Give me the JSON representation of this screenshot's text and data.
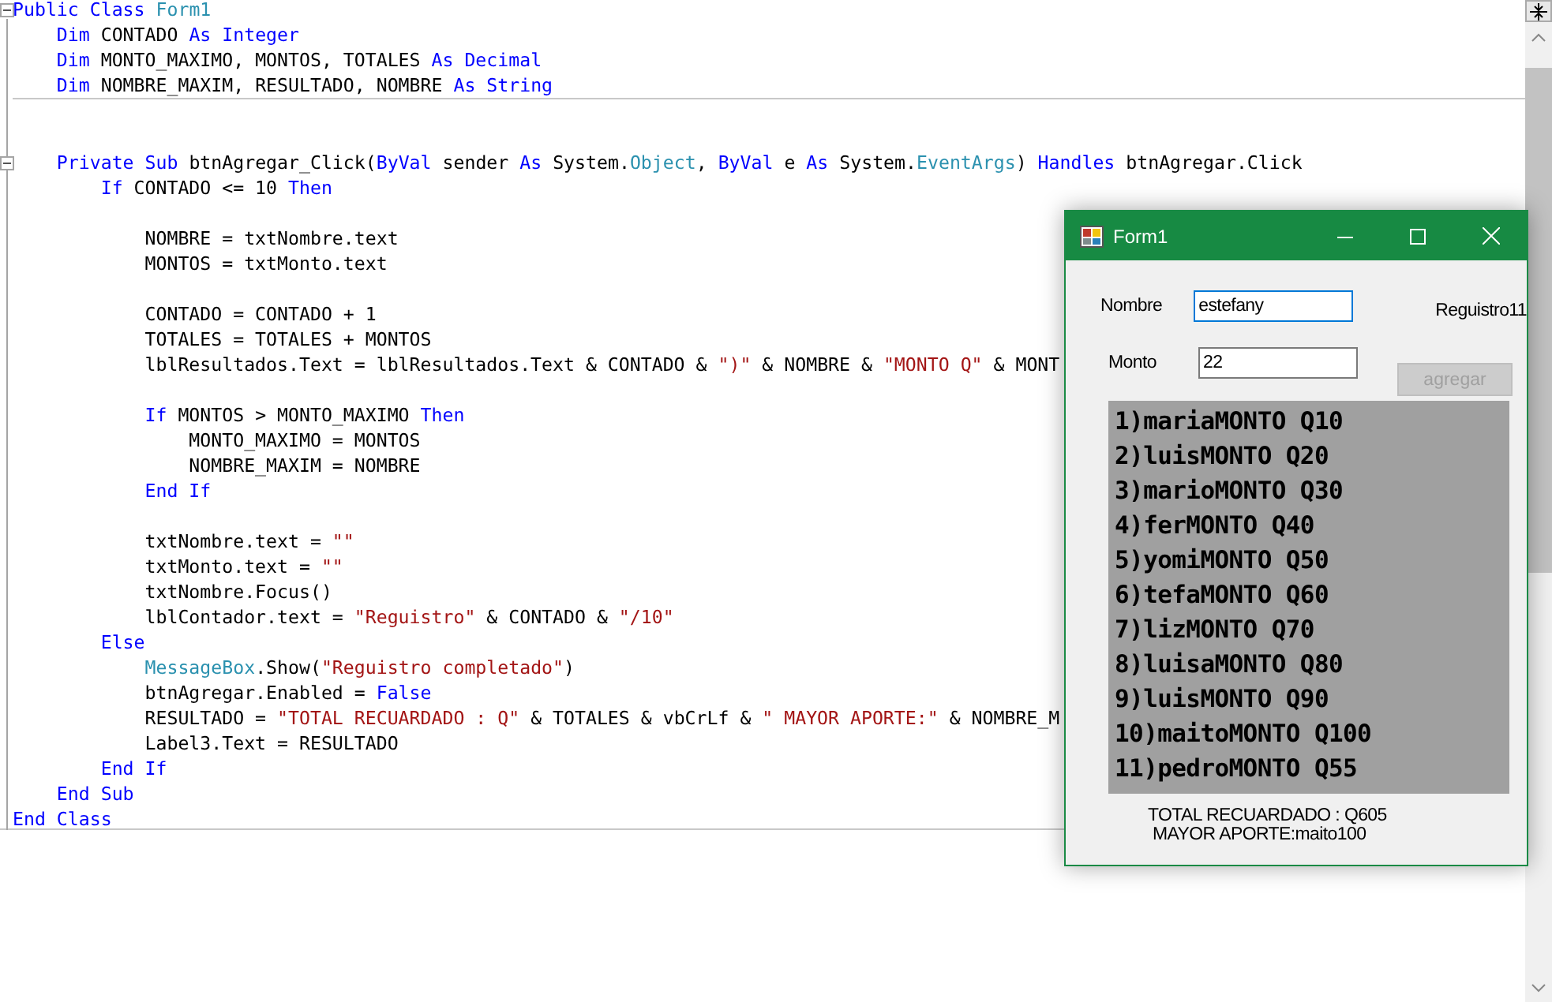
{
  "editor": {
    "lines": [
      {
        "kind": "fold",
        "expanded": true,
        "tokens": [
          {
            "kind": "kw",
            "text": "Public Class "
          },
          {
            "kind": "type",
            "text": "Form1"
          }
        ]
      },
      {
        "kind": "code",
        "tokens": [
          {
            "kind": "kw",
            "text": "    Dim "
          },
          {
            "kind": "plain",
            "text": "CONTADO "
          },
          {
            "kind": "kw",
            "text": "As Integer"
          }
        ]
      },
      {
        "kind": "code",
        "tokens": [
          {
            "kind": "kw",
            "text": "    Dim "
          },
          {
            "kind": "plain",
            "text": "MONTO_MAXIMO, MONTOS, TOTALES "
          },
          {
            "kind": "kw",
            "text": "As Decimal"
          }
        ]
      },
      {
        "kind": "code",
        "tokens": [
          {
            "kind": "kw",
            "text": "    Dim "
          },
          {
            "kind": "plain",
            "text": "NOMBRE_MAXIM, RESULTADO, NOMBRE "
          },
          {
            "kind": "kw",
            "text": "As String"
          }
        ]
      },
      {
        "kind": "rule"
      },
      {
        "kind": "blank"
      },
      {
        "kind": "blank"
      },
      {
        "kind": "fold",
        "expanded": true,
        "tokens": [
          {
            "kind": "kw",
            "text": "    Private Sub "
          },
          {
            "kind": "plain",
            "text": "btnAgregar_Click("
          },
          {
            "kind": "kw",
            "text": "ByVal "
          },
          {
            "kind": "plain",
            "text": "sender "
          },
          {
            "kind": "kw",
            "text": "As "
          },
          {
            "kind": "plain",
            "text": "System."
          },
          {
            "kind": "type",
            "text": "Object"
          },
          {
            "kind": "plain",
            "text": ", "
          },
          {
            "kind": "kw",
            "text": "ByVal "
          },
          {
            "kind": "plain",
            "text": "e "
          },
          {
            "kind": "kw",
            "text": "As "
          },
          {
            "kind": "plain",
            "text": "System."
          },
          {
            "kind": "type",
            "text": "EventArgs"
          },
          {
            "kind": "plain",
            "text": ") "
          },
          {
            "kind": "kw",
            "text": "Handles "
          },
          {
            "kind": "plain",
            "text": "btnAgregar.Click"
          }
        ]
      },
      {
        "kind": "code",
        "tokens": [
          {
            "kind": "kw",
            "text": "        If "
          },
          {
            "kind": "plain",
            "text": "CONTADO <= 10 "
          },
          {
            "kind": "kw",
            "text": "Then"
          }
        ]
      },
      {
        "kind": "blank"
      },
      {
        "kind": "code",
        "tokens": [
          {
            "kind": "plain",
            "text": "            NOMBRE = txtNombre.text"
          }
        ]
      },
      {
        "kind": "code",
        "tokens": [
          {
            "kind": "plain",
            "text": "            MONTOS = txtMonto.text"
          }
        ]
      },
      {
        "kind": "blank"
      },
      {
        "kind": "code",
        "tokens": [
          {
            "kind": "plain",
            "text": "            CONTADO = CONTADO + 1"
          }
        ]
      },
      {
        "kind": "code",
        "tokens": [
          {
            "kind": "plain",
            "text": "            TOTALES = TOTALES + MONTOS"
          }
        ]
      },
      {
        "kind": "code",
        "tokens": [
          {
            "kind": "plain",
            "text": "            lblResultados.Text = lblResultados.Text & CONTADO & "
          },
          {
            "kind": "str",
            "text": "\")\""
          },
          {
            "kind": "plain",
            "text": " & NOMBRE & "
          },
          {
            "kind": "str",
            "text": "\"MONTO Q\""
          },
          {
            "kind": "plain",
            "text": " & MONT"
          }
        ]
      },
      {
        "kind": "blank"
      },
      {
        "kind": "code",
        "tokens": [
          {
            "kind": "kw",
            "text": "            If "
          },
          {
            "kind": "plain",
            "text": "MONTOS > MONTO_MAXIMO "
          },
          {
            "kind": "kw",
            "text": "Then"
          }
        ]
      },
      {
        "kind": "code",
        "tokens": [
          {
            "kind": "plain",
            "text": "                MONTO_MAXIMO = MONTOS"
          }
        ]
      },
      {
        "kind": "code",
        "tokens": [
          {
            "kind": "plain",
            "text": "                NOMBRE_MAXIM = NOMBRE"
          }
        ]
      },
      {
        "kind": "code",
        "tokens": [
          {
            "kind": "kw",
            "text": "            End If"
          }
        ]
      },
      {
        "kind": "blank"
      },
      {
        "kind": "code",
        "tokens": [
          {
            "kind": "plain",
            "text": "            txtNombre.text = "
          },
          {
            "kind": "str",
            "text": "\"\""
          }
        ]
      },
      {
        "kind": "code",
        "tokens": [
          {
            "kind": "plain",
            "text": "            txtMonto.text = "
          },
          {
            "kind": "str",
            "text": "\"\""
          }
        ]
      },
      {
        "kind": "code",
        "tokens": [
          {
            "kind": "plain",
            "text": "            txtNombre.Focus()"
          }
        ]
      },
      {
        "kind": "code",
        "tokens": [
          {
            "kind": "plain",
            "text": "            lblContador.text = "
          },
          {
            "kind": "str",
            "text": "\"Reguistro\""
          },
          {
            "kind": "plain",
            "text": " & CONTADO & "
          },
          {
            "kind": "str",
            "text": "\"/10\""
          }
        ]
      },
      {
        "kind": "code",
        "tokens": [
          {
            "kind": "kw",
            "text": "        Else"
          }
        ]
      },
      {
        "kind": "code",
        "tokens": [
          {
            "kind": "type",
            "text": "            MessageBox"
          },
          {
            "kind": "plain",
            "text": ".Show("
          },
          {
            "kind": "str",
            "text": "\"Reguistro completado\""
          },
          {
            "kind": "plain",
            "text": ")"
          }
        ]
      },
      {
        "kind": "code",
        "tokens": [
          {
            "kind": "plain",
            "text": "            btnAgregar.Enabled = "
          },
          {
            "kind": "kw",
            "text": "False"
          }
        ]
      },
      {
        "kind": "code",
        "tokens": [
          {
            "kind": "plain",
            "text": "            RESULTADO = "
          },
          {
            "kind": "str",
            "text": "\"TOTAL RECUARDADO : Q\""
          },
          {
            "kind": "plain",
            "text": " & TOTALES & vbCrLf & "
          },
          {
            "kind": "str",
            "text": "\" MAYOR APORTE:\""
          },
          {
            "kind": "plain",
            "text": " & NOMBRE_M"
          }
        ]
      },
      {
        "kind": "code",
        "tokens": [
          {
            "kind": "plain",
            "text": "            Label3.Text = RESULTADO"
          }
        ]
      },
      {
        "kind": "code",
        "tokens": [
          {
            "kind": "kw",
            "text": "        End If"
          }
        ]
      },
      {
        "kind": "code",
        "tokens": [
          {
            "kind": "kw",
            "text": "    End Sub"
          }
        ]
      },
      {
        "kind": "code",
        "tokens": [
          {
            "kind": "kw",
            "text": "End Class"
          }
        ]
      }
    ]
  },
  "form": {
    "title": "Form1",
    "fields": [
      {
        "label": "Nombre",
        "value": "estefany",
        "focused": true
      },
      {
        "label": "Monto",
        "value": "22",
        "focused": false
      }
    ],
    "counter": "Reguistro11",
    "button": {
      "label": "agregar",
      "disabled": true
    },
    "results": [
      "1)mariaMONTO Q10",
      "2)luisMONTO Q20",
      "3)marioMONTO Q30",
      "4)ferMONTO Q40",
      "5)yomiMONTO Q50",
      "6)tefaMONTO Q60",
      "7)lizMONTO Q70",
      "8)luisaMONTO Q80",
      "9)luisMONTO Q90",
      "10)maitoMONTO Q100",
      "11)pedroMONTO Q55"
    ],
    "summary": [
      "TOTAL RECUARDADO : Q605",
      "MAYOR APORTE:maito100"
    ]
  }
}
